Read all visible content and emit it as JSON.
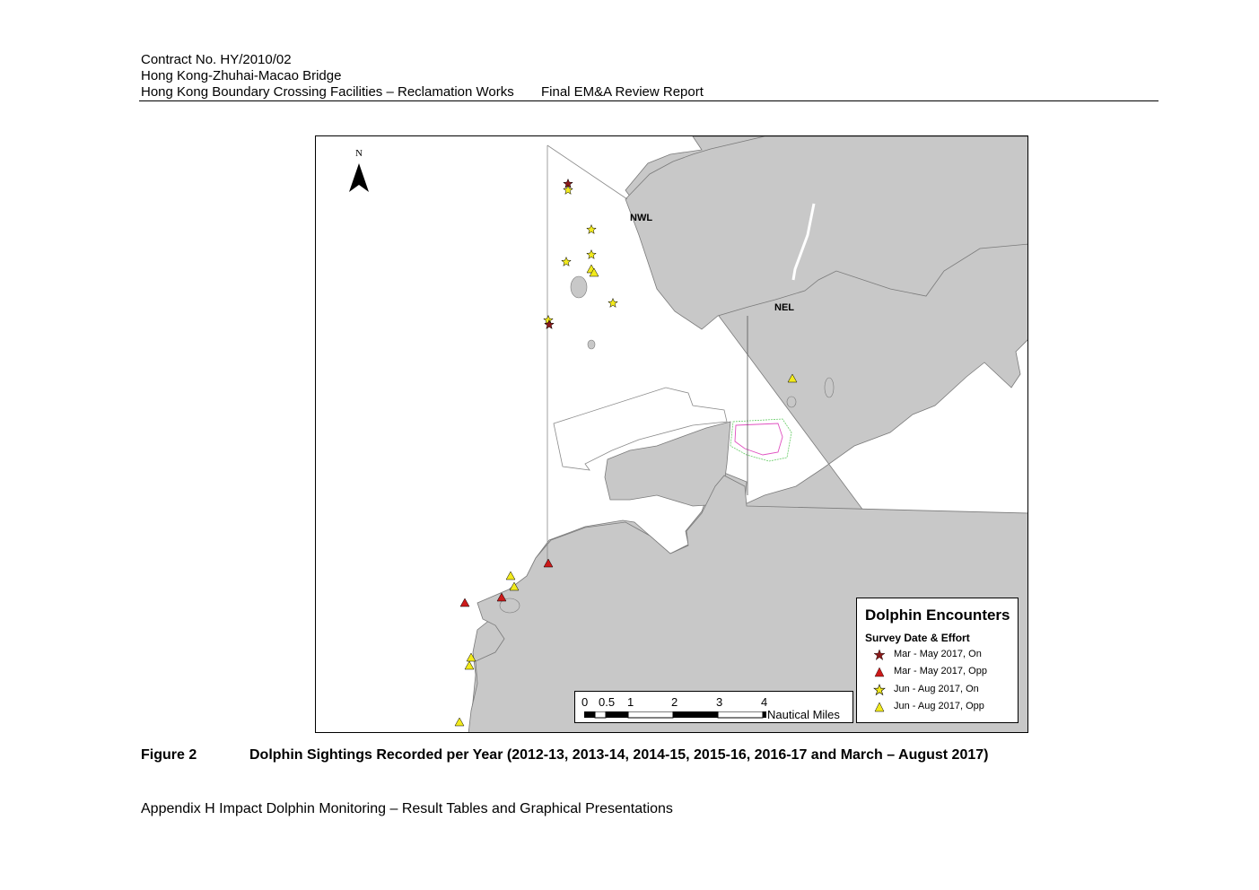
{
  "header": {
    "contract": "Contract No. HY/2010/02",
    "project": "Hong Kong-Zhuhai-Macao Bridge",
    "works": "Hong Kong Boundary Crossing Facilities – Reclamation Works",
    "report": "Final EM&A Review Report"
  },
  "map": {
    "north_label": "N",
    "area_labels": [
      "NWL",
      "NEL"
    ],
    "colors": {
      "land": "#c8c8c8",
      "on_star": "#8b1a1a",
      "opp_red": "#cc1a1a",
      "yellow": "#f2ea1c"
    }
  },
  "legend": {
    "title": "Dolphin Encounters",
    "subtitle": "Survey Date & Effort",
    "items": [
      {
        "symbol": "star",
        "color": "#8b1a1a",
        "label": "Mar - May 2017, On"
      },
      {
        "symbol": "triangle",
        "color": "#cc1a1a",
        "label": "Mar - May 2017, Opp"
      },
      {
        "symbol": "star",
        "color": "#f2ea1c",
        "label": "Jun - Aug 2017, On"
      },
      {
        "symbol": "triangle",
        "color": "#f2ea1c",
        "label": "Jun - Aug 2017, Opp"
      }
    ]
  },
  "scale": {
    "ticks": [
      "0",
      "0.5",
      "1",
      "2",
      "3",
      "4"
    ],
    "units": "Nautical Miles"
  },
  "caption": {
    "label": "Figure 2",
    "text": "Dolphin Sightings Recorded per Year (2012-13, 2013-14, 2014-15, 2015-16, 2016-17 and March – August 2017)"
  },
  "footer": "Appendix H Impact Dolphin Monitoring – Result Tables and Graphical Presentations"
}
